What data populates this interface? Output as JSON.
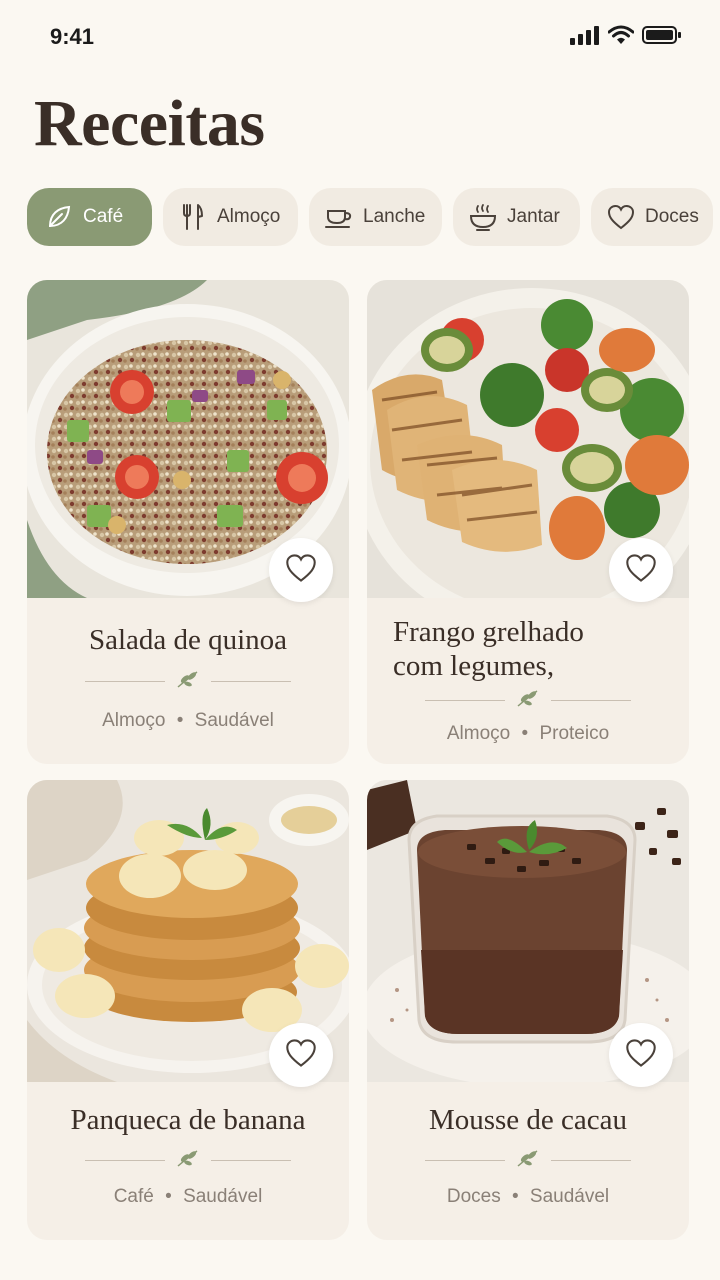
{
  "status_bar": {
    "time": "9:41"
  },
  "header": {
    "title": "Receitas"
  },
  "categories": [
    {
      "label": "Café",
      "icon": "leaf-icon",
      "active": true
    },
    {
      "label": "Almoço",
      "icon": "fork-knife-icon",
      "active": false
    },
    {
      "label": "Lanche",
      "icon": "cup-icon",
      "active": false
    },
    {
      "label": "Jantar",
      "icon": "steaming-bowl-icon",
      "active": false
    },
    {
      "label": "Doces",
      "icon": "heart-icon",
      "active": false
    }
  ],
  "recipes": [
    {
      "title": "Salada de quinoa",
      "category": "Almoço",
      "tag": "Saudável",
      "favorite_icon": "heart-outline-icon"
    },
    {
      "title_line1": "Frango grelhado",
      "title_line2": "com legumes,",
      "category": "Almoço",
      "tag": "Proteico",
      "favorite_icon": "heart-outline-icon"
    },
    {
      "title": "Panqueca de banana",
      "category": "Café",
      "tag": "Saudável",
      "favorite_icon": "heart-outline-icon"
    },
    {
      "title": "Mousse de cacau",
      "category": "Doces",
      "tag": "Saudável",
      "favorite_icon": "heart-outline-icon"
    }
  ],
  "meta_separator": "•",
  "colors": {
    "accent": "#8a9a74",
    "background": "#fbf8f2",
    "card": "#f5efe7",
    "chip": "#f1ebe2"
  }
}
